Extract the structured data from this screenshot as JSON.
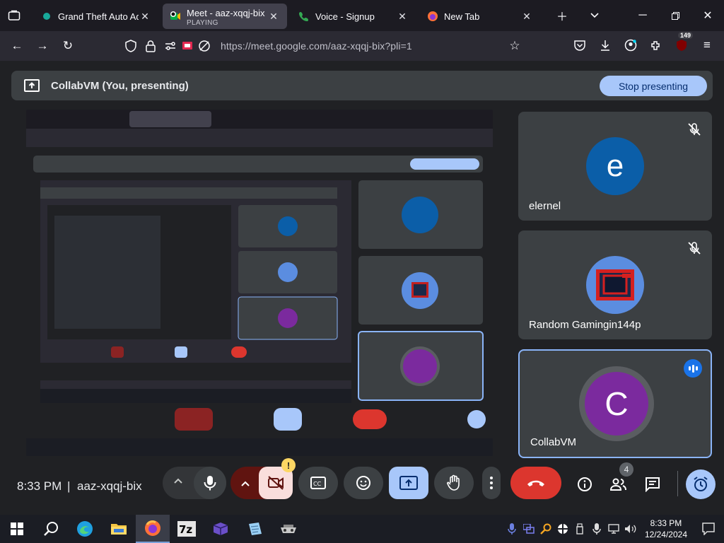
{
  "browser": {
    "tabs": [
      {
        "label": "Grand Theft Auto Adve",
        "icon": "gta-favicon",
        "active": false
      },
      {
        "label": "Meet - aaz-xqqj-bix",
        "sub": "PLAYING",
        "icon": "meet-favicon",
        "active": true
      },
      {
        "label": "Voice - Signup",
        "icon": "voice-favicon",
        "active": false
      },
      {
        "label": "New Tab",
        "icon": "firefox-favicon",
        "active": false
      }
    ],
    "url": "https://meet.google.com/aaz-xqqj-bix?pli=1",
    "extension_badge": "149"
  },
  "meet": {
    "banner_title": "CollabVM (You, presenting)",
    "stop_presenting_label": "Stop presenting",
    "time": "8:33 PM",
    "divider": "|",
    "meeting_code": "aaz-xqqj-bix",
    "people_count": "4",
    "participants": [
      {
        "name": "elernel",
        "initial": "e",
        "color": "#0b5ea8",
        "muted": true,
        "speaking": false
      },
      {
        "name": "Random Gamingin144p",
        "initial": "",
        "color": "#5b8de0",
        "muted": true,
        "speaking": false
      },
      {
        "name": "CollabVM",
        "initial": "C",
        "color": "#7b2a9e",
        "muted": false,
        "speaking": true
      }
    ],
    "alert_badge": "!",
    "accent": "#a8c7fa",
    "hangup_color": "#dc362e"
  },
  "taskbar": {
    "time": "8:33 PM",
    "date": "12/24/2024",
    "apps": [
      "windows-start",
      "search",
      "edge",
      "file-explorer",
      "firefox",
      "7zip",
      "vm-app",
      "notepad-app",
      "game-app"
    ]
  }
}
